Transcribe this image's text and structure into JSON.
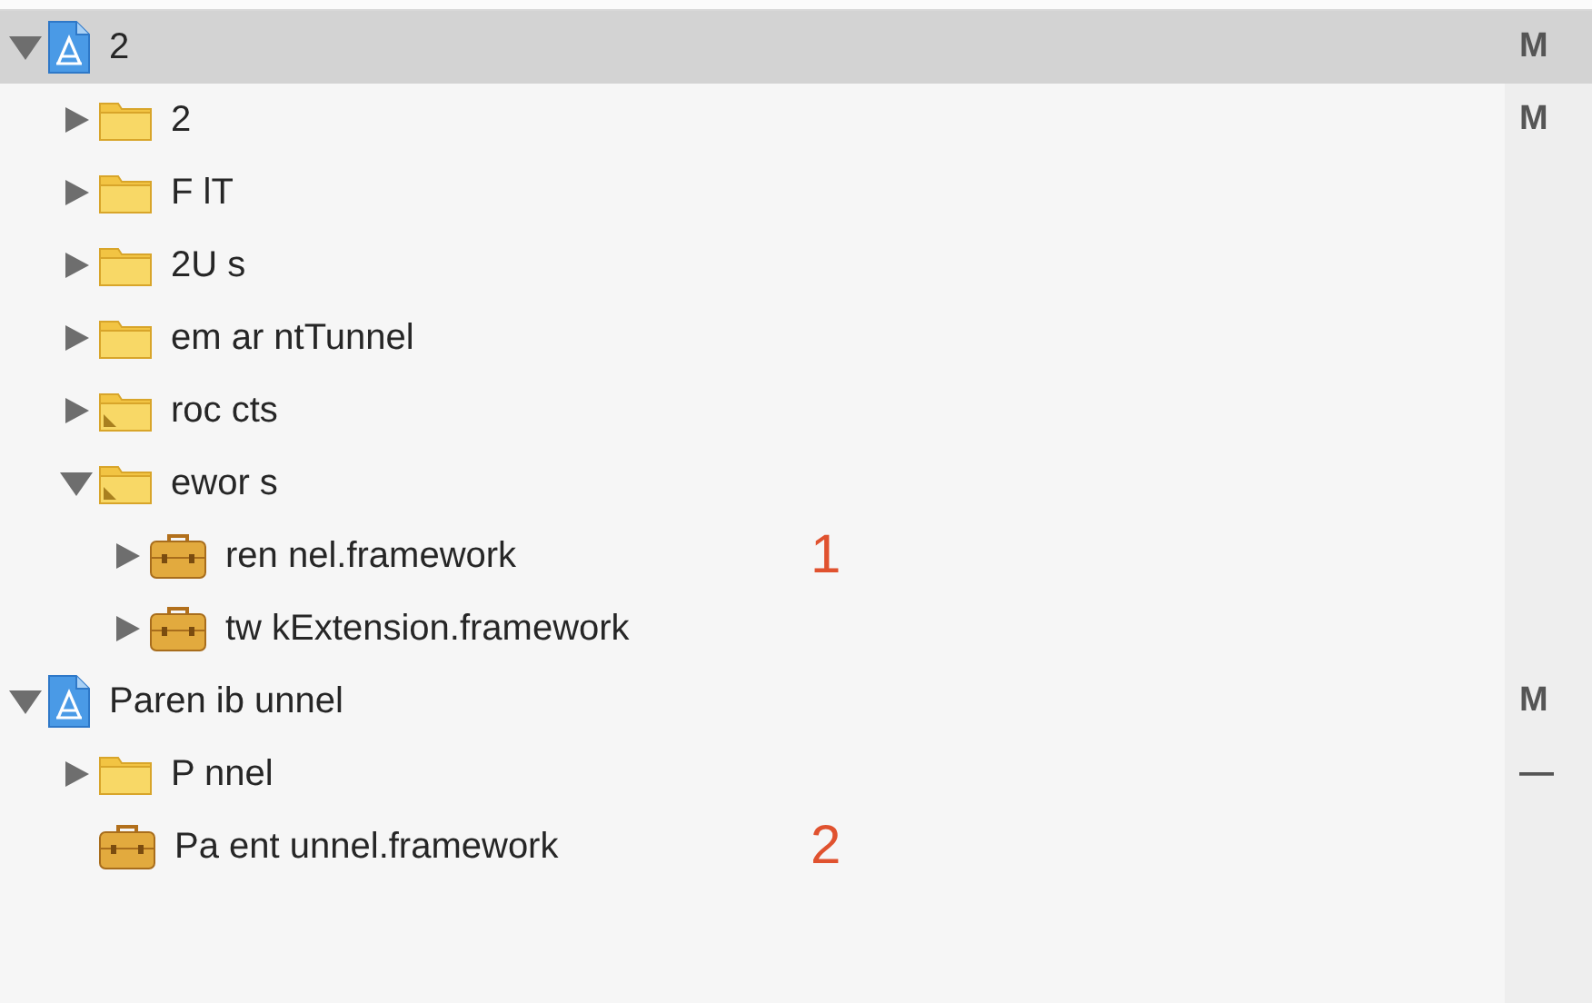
{
  "navigator": {
    "items": [
      {
        "name": "2",
        "kind": "project",
        "expanded": true,
        "selected": true,
        "status": "M",
        "children": [
          {
            "name": "2",
            "kind": "folder",
            "expanded": false,
            "selected": false,
            "status": "M"
          },
          {
            "name": "F lT",
            "kind": "folder",
            "expanded": false,
            "selected": false
          },
          {
            "name": "2U s",
            "kind": "folder",
            "expanded": false,
            "selected": false
          },
          {
            "name": "em ar ntTunnel",
            "kind": "folder",
            "expanded": false,
            "selected": false
          },
          {
            "name": "roc cts",
            "kind": "group-folder",
            "expanded": false,
            "selected": false
          },
          {
            "name": "ewor s",
            "kind": "group-folder",
            "expanded": true,
            "selected": false,
            "children": [
              {
                "name": "ren nel.framework",
                "kind": "framework",
                "expanded": false,
                "selected": false,
                "annotation": "1"
              },
              {
                "name": "tw kExtension.framework",
                "kind": "framework",
                "expanded": false,
                "selected": false
              }
            ]
          }
        ]
      },
      {
        "name": "Paren ib unnel",
        "kind": "project",
        "expanded": true,
        "selected": false,
        "status": "M",
        "children": [
          {
            "name": "P nnel",
            "kind": "folder",
            "expanded": false,
            "selected": false,
            "status": "—"
          },
          {
            "name": "Pa ent unnel.framework",
            "kind": "framework",
            "selected": false,
            "annotation": "2"
          }
        ]
      }
    ]
  }
}
